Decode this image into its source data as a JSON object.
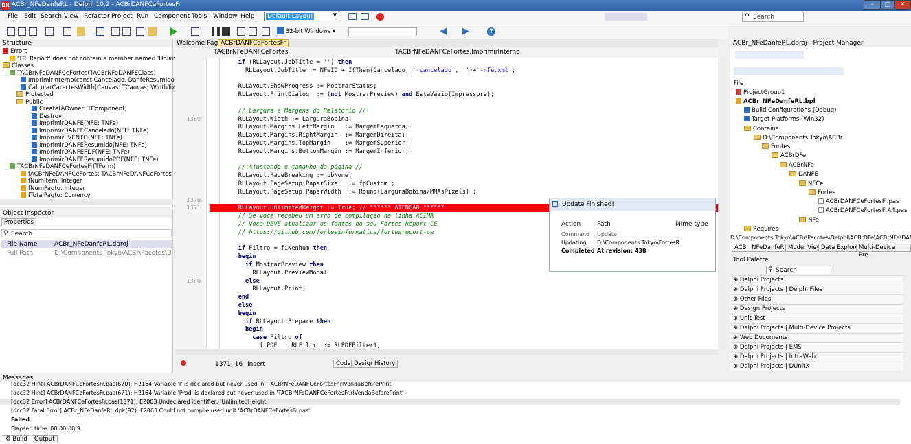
{
  "window": {
    "title": "ACBr_NFeDanfeRL - Delphi 10.2 - ACBrDANFCeFortesFr",
    "minimize": "–",
    "maximize": "□",
    "close": "✕"
  },
  "menu": [
    "File",
    "Edit",
    "Search",
    "View",
    "Refactor",
    "Project",
    "Run",
    "Component",
    "Tools",
    "Window",
    "Help"
  ],
  "layout_select": "Default Layout",
  "top_search_placeholder": "Search",
  "platform_select": "32-bit Windows",
  "structure": {
    "title": "Structure",
    "items": [
      "Errors",
      "'TRLReport' does not contain a member named 'Unlim",
      "Classes",
      "TACBrNFeDANFCeFortes(TACBrNFeDANFEClass)",
      "ImprimirInterno(const Cancelado, DanfeResumido:",
      "CalcularCaractesWidth(Canvas: TCanvas; WidthTot",
      "Protected",
      "Public",
      "Create(AOwner: TComponent)",
      "Destroy",
      "ImprimirDANFE(NFE: TNFe)",
      "ImprimirDANFECancelado(NFE: TNFe)",
      "ImprimirEVENTO(NFE: TNFe)",
      "ImprimirDANFEResumido(NFE: TNFe)",
      "ImprimirDANFEPDF(NFE: TNFe)",
      "ImprimirDANFEResumidoPDF(NFE: TNFe)",
      "TACBrNFeDANFCeFortesFr(TForm)",
      "fACBrNFeDANFCeFortes: TACBrNFeDANFCeFortes",
      "fNumItem: Integer",
      "fNumPagto: Integer",
      "fTotalPagto: Currency"
    ]
  },
  "inspector": {
    "title": "Object Inspector",
    "tab": "Properties",
    "search": "Search",
    "rows": [
      {
        "name": "File Name",
        "value": "ACBr_NFeDanfeRL.dproj"
      },
      {
        "name": "Full Path",
        "value": "D:\\Components Tokyo\\ACBr\\Pacotes\\Delphi\\A"
      }
    ]
  },
  "editor": {
    "tabs": [
      "Welcome Page",
      "ACBrDANFCeFortesFr"
    ],
    "class_select": "TACBrNFeDANFCeFortes",
    "method_select": "TACBrNFeDANFCeFortes.ImprimirInterno",
    "line_numbers": [
      {
        "n": "1360",
        "row": 7
      },
      {
        "n": "1370",
        "row": 17
      },
      {
        "n": "1371",
        "row": 18
      },
      {
        "n": "1380",
        "row": 27
      }
    ],
    "status": {
      "pos": "1371: 16",
      "mode": "Insert"
    },
    "bottom_tabs": [
      "Code",
      "Design",
      "History"
    ]
  },
  "update_popup": {
    "title": "Update Finished!",
    "headers": [
      "Action",
      "Path",
      "Mime type"
    ],
    "rows": [
      [
        "Command",
        "Update",
        ""
      ],
      [
        "Updating",
        "D:\\Components Tokyo\\FortesR",
        ""
      ],
      [
        "Completed",
        "At revision: 438",
        ""
      ]
    ]
  },
  "project_manager": {
    "title": "ACBr_NFeDanfeRL.dproj - Project Manager",
    "file_label": "File",
    "items": [
      "ProjectGroup1",
      "ACBr_NFeDanfeRL.bpl",
      "Build Configurations (Debug)",
      "Target Platforms (Win32)",
      "Contains",
      "D:\\Components Tokyo\\ACBr",
      "Fontes",
      "ACBrDFe",
      "ACBrNFe",
      "DANFE",
      "NFCe",
      "Fortes",
      "ACBrDANFCeFortesFr.pas",
      "ACBrDANFCeFortesFrA4.pas",
      "NFe",
      "Requires"
    ],
    "path": "D:\\Components Tokyo\\ACBr\\Pacotes\\Delphi\\ACBrDFe\\ACBrNFe\\DANF",
    "tabs": [
      "ACBr_NFeDanfeR...",
      "Model View",
      "Data Explorer",
      "Multi-Device Pre..."
    ]
  },
  "palette": {
    "title": "Tool Palette",
    "search": "Search",
    "items": [
      "Delphi Projects",
      "Delphi Projects | Delphi Files",
      "Other Files",
      "Design Projects",
      "Unit Test",
      "Delphi Projects | Multi-Device Projects",
      "Web Documents",
      "Delphi Projects | EMS",
      "Delphi Projects | IntraWeb",
      "Delphi Projects | DUnitX"
    ]
  },
  "messages": {
    "title": "Messages",
    "lines": [
      "[dcc32 Hint] ACBrDANFCeFortesFr.pas(670): H2164 Variable 'I' is declared but never used in 'TACBrNFeDANFCeFortesFr.rlVendaBeforePrint'",
      "[dcc32 Hint] ACBrDANFCeFortesFr.pas(671): H2164 Variable 'Prod' is declared but never used in 'TACBrNFeDANFCeFortesFr.rlVendaBeforePrint'",
      "[dcc32 Error] ACBrDANFCeFortesFr.pas(1371): E2003 Undeclared identifier: 'UnlimitedHeight'",
      "[dcc32 Fatal Error] ACBr_NFeDanfeRL.dpk(92): F2063 Could not compile used unit 'ACBrDANFCeFortesFr.pas'",
      "Failed",
      "Elapsed time: 00:00:00.9"
    ],
    "tabs": [
      "Build",
      "Output"
    ]
  },
  "colors": {
    "error": "#ff0000",
    "accent": "#3399ff",
    "title": "#2f63a8"
  }
}
